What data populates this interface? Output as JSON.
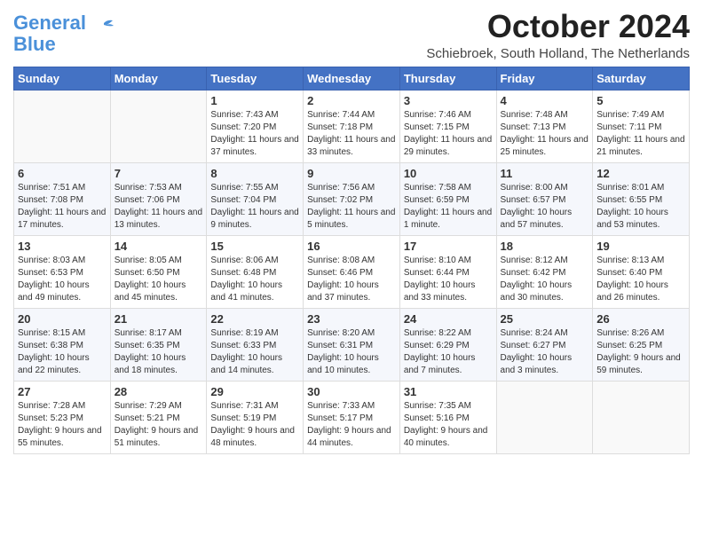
{
  "header": {
    "logo_line1": "General",
    "logo_line2": "Blue",
    "month": "October 2024",
    "location": "Schiebroek, South Holland, The Netherlands"
  },
  "days_of_week": [
    "Sunday",
    "Monday",
    "Tuesday",
    "Wednesday",
    "Thursday",
    "Friday",
    "Saturday"
  ],
  "weeks": [
    [
      {
        "day": "",
        "content": ""
      },
      {
        "day": "",
        "content": ""
      },
      {
        "day": "1",
        "content": "Sunrise: 7:43 AM\nSunset: 7:20 PM\nDaylight: 11 hours and 37 minutes."
      },
      {
        "day": "2",
        "content": "Sunrise: 7:44 AM\nSunset: 7:18 PM\nDaylight: 11 hours and 33 minutes."
      },
      {
        "day": "3",
        "content": "Sunrise: 7:46 AM\nSunset: 7:15 PM\nDaylight: 11 hours and 29 minutes."
      },
      {
        "day": "4",
        "content": "Sunrise: 7:48 AM\nSunset: 7:13 PM\nDaylight: 11 hours and 25 minutes."
      },
      {
        "day": "5",
        "content": "Sunrise: 7:49 AM\nSunset: 7:11 PM\nDaylight: 11 hours and 21 minutes."
      }
    ],
    [
      {
        "day": "6",
        "content": "Sunrise: 7:51 AM\nSunset: 7:08 PM\nDaylight: 11 hours and 17 minutes."
      },
      {
        "day": "7",
        "content": "Sunrise: 7:53 AM\nSunset: 7:06 PM\nDaylight: 11 hours and 13 minutes."
      },
      {
        "day": "8",
        "content": "Sunrise: 7:55 AM\nSunset: 7:04 PM\nDaylight: 11 hours and 9 minutes."
      },
      {
        "day": "9",
        "content": "Sunrise: 7:56 AM\nSunset: 7:02 PM\nDaylight: 11 hours and 5 minutes."
      },
      {
        "day": "10",
        "content": "Sunrise: 7:58 AM\nSunset: 6:59 PM\nDaylight: 11 hours and 1 minute."
      },
      {
        "day": "11",
        "content": "Sunrise: 8:00 AM\nSunset: 6:57 PM\nDaylight: 10 hours and 57 minutes."
      },
      {
        "day": "12",
        "content": "Sunrise: 8:01 AM\nSunset: 6:55 PM\nDaylight: 10 hours and 53 minutes."
      }
    ],
    [
      {
        "day": "13",
        "content": "Sunrise: 8:03 AM\nSunset: 6:53 PM\nDaylight: 10 hours and 49 minutes."
      },
      {
        "day": "14",
        "content": "Sunrise: 8:05 AM\nSunset: 6:50 PM\nDaylight: 10 hours and 45 minutes."
      },
      {
        "day": "15",
        "content": "Sunrise: 8:06 AM\nSunset: 6:48 PM\nDaylight: 10 hours and 41 minutes."
      },
      {
        "day": "16",
        "content": "Sunrise: 8:08 AM\nSunset: 6:46 PM\nDaylight: 10 hours and 37 minutes."
      },
      {
        "day": "17",
        "content": "Sunrise: 8:10 AM\nSunset: 6:44 PM\nDaylight: 10 hours and 33 minutes."
      },
      {
        "day": "18",
        "content": "Sunrise: 8:12 AM\nSunset: 6:42 PM\nDaylight: 10 hours and 30 minutes."
      },
      {
        "day": "19",
        "content": "Sunrise: 8:13 AM\nSunset: 6:40 PM\nDaylight: 10 hours and 26 minutes."
      }
    ],
    [
      {
        "day": "20",
        "content": "Sunrise: 8:15 AM\nSunset: 6:38 PM\nDaylight: 10 hours and 22 minutes."
      },
      {
        "day": "21",
        "content": "Sunrise: 8:17 AM\nSunset: 6:35 PM\nDaylight: 10 hours and 18 minutes."
      },
      {
        "day": "22",
        "content": "Sunrise: 8:19 AM\nSunset: 6:33 PM\nDaylight: 10 hours and 14 minutes."
      },
      {
        "day": "23",
        "content": "Sunrise: 8:20 AM\nSunset: 6:31 PM\nDaylight: 10 hours and 10 minutes."
      },
      {
        "day": "24",
        "content": "Sunrise: 8:22 AM\nSunset: 6:29 PM\nDaylight: 10 hours and 7 minutes."
      },
      {
        "day": "25",
        "content": "Sunrise: 8:24 AM\nSunset: 6:27 PM\nDaylight: 10 hours and 3 minutes."
      },
      {
        "day": "26",
        "content": "Sunrise: 8:26 AM\nSunset: 6:25 PM\nDaylight: 9 hours and 59 minutes."
      }
    ],
    [
      {
        "day": "27",
        "content": "Sunrise: 7:28 AM\nSunset: 5:23 PM\nDaylight: 9 hours and 55 minutes."
      },
      {
        "day": "28",
        "content": "Sunrise: 7:29 AM\nSunset: 5:21 PM\nDaylight: 9 hours and 51 minutes."
      },
      {
        "day": "29",
        "content": "Sunrise: 7:31 AM\nSunset: 5:19 PM\nDaylight: 9 hours and 48 minutes."
      },
      {
        "day": "30",
        "content": "Sunrise: 7:33 AM\nSunset: 5:17 PM\nDaylight: 9 hours and 44 minutes."
      },
      {
        "day": "31",
        "content": "Sunrise: 7:35 AM\nSunset: 5:16 PM\nDaylight: 9 hours and 40 minutes."
      },
      {
        "day": "",
        "content": ""
      },
      {
        "day": "",
        "content": ""
      }
    ]
  ]
}
